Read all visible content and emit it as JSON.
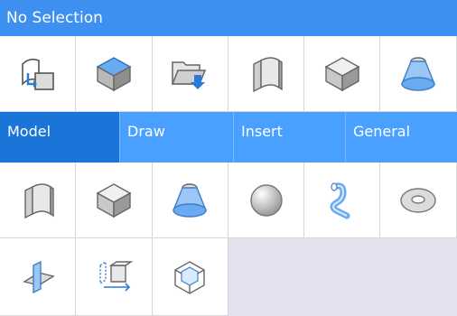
{
  "header": {
    "title": "No Selection"
  },
  "tabs": [
    {
      "label": "Model",
      "active": true
    },
    {
      "label": "Draw",
      "active": false
    },
    {
      "label": "Insert",
      "active": false
    },
    {
      "label": "General",
      "active": false
    }
  ],
  "toolbar_row1": [
    "extrude-region-icon",
    "solid-box-blue-top-icon",
    "open-folder-arrow-icon",
    "polysolid-icon",
    "box-icon",
    "cone-icon"
  ],
  "toolbar_row2": [
    "polysolid-icon",
    "box-icon",
    "cone-icon",
    "sphere-icon",
    "sweep-tube-icon",
    "torus-icon"
  ],
  "toolbar_row3": [
    "intersect-planes-icon",
    "copy-object-icon",
    "wire-cube-icon"
  ],
  "colors": {
    "header": "#3d8ff0",
    "tabbar": "#49a0ff",
    "tab_active": "#1b74d7",
    "blank": "#e3e1ee"
  }
}
